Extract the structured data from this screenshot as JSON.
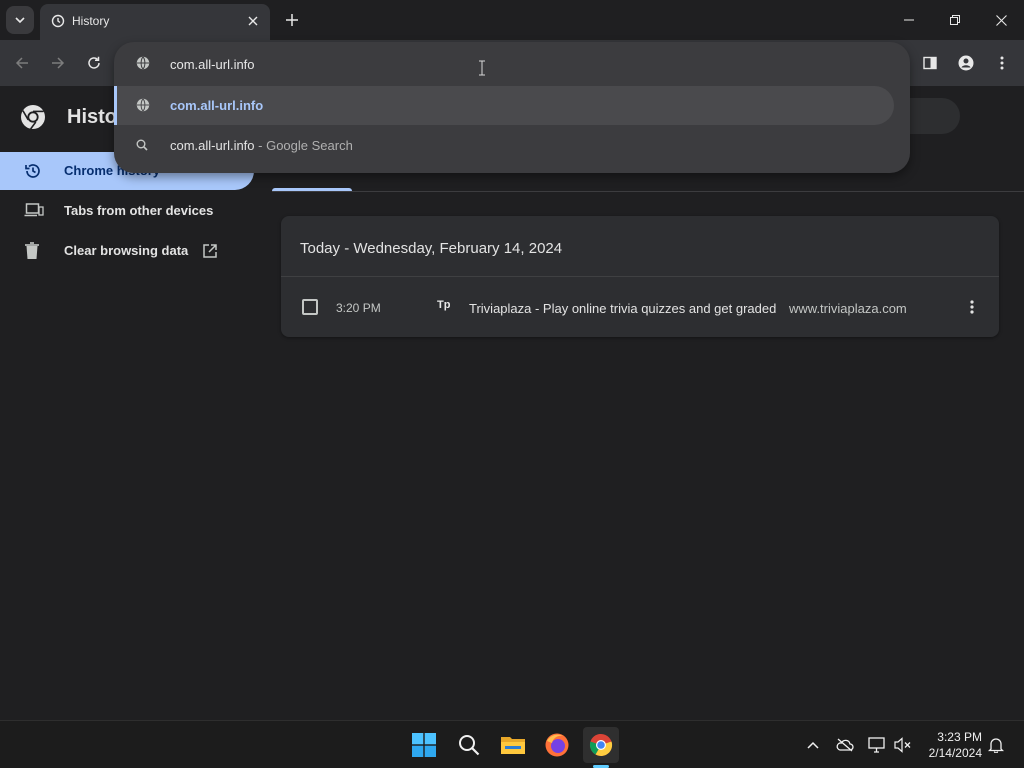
{
  "browser": {
    "tab": {
      "title": "History"
    },
    "omnibox": {
      "value": "com.all-url.info",
      "suggestions": [
        {
          "text": "com.all-url.info",
          "subtext": "",
          "icon": "globe-icon"
        },
        {
          "text": "com.all-url.info",
          "subtext": " - Google Search",
          "icon": "search-icon"
        }
      ]
    }
  },
  "page": {
    "title": "History",
    "sidebar": {
      "items": [
        {
          "label": "Chrome history",
          "icon": "history-icon"
        },
        {
          "label": "Tabs from other devices",
          "icon": "devices-icon"
        },
        {
          "label": "Clear browsing data",
          "icon": "trash-icon"
        }
      ]
    },
    "history": {
      "date_heading": "Today - Wednesday, February 14, 2024",
      "entries": [
        {
          "time": "3:20 PM",
          "favicon": "Tp",
          "title": "Triviaplaza - Play online trivia quizzes and get graded",
          "domain": "www.triviaplaza.com"
        }
      ]
    }
  },
  "taskbar": {
    "clock": {
      "time": "3:23 PM",
      "date": "2/14/2024"
    }
  },
  "colors": {
    "accent": "#a8c7fa",
    "background": "#1f1f21",
    "toolbar": "#35363a",
    "card": "#2d2e31"
  }
}
